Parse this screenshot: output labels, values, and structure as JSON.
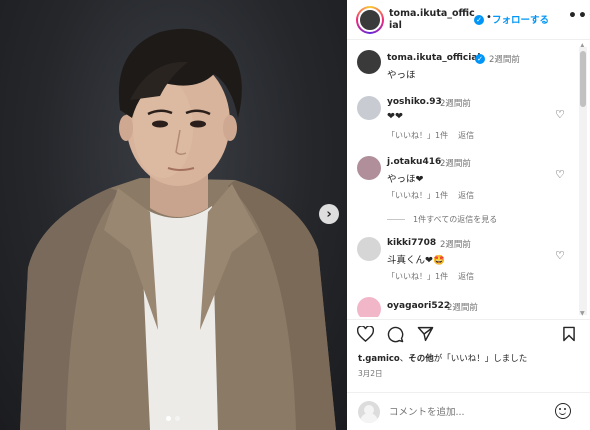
{
  "post": {
    "username": "toma.ikuta_official",
    "follow_label": "フォローする",
    "separator": "•",
    "more_label": "•••",
    "verified_mark": "✓",
    "next_arrow": "›",
    "carousel": {
      "slides": 2,
      "active_index": 0
    }
  },
  "caption": {
    "username": "toma.ikuta_official",
    "time": "2週間前",
    "text": "やっほ"
  },
  "comments": [
    {
      "username": "yoshiko.93",
      "time": "2週間前",
      "text": "❤❤",
      "likes": "「いいね！」1件",
      "reply": "返信",
      "avatar_color": "#c8ccd2"
    },
    {
      "username": "j.otaku416",
      "time": "2週間前",
      "text": "やっほ❤",
      "likes": "「いいね！」1件",
      "reply": "返信",
      "avatar_color": "#b08f9a"
    },
    {
      "username": "kikki7708",
      "time": "2週間前",
      "text": "斗真くん❤🤩",
      "likes": "「いいね！」1件",
      "reply": "返信",
      "avatar_color": "#d6d6d6"
    },
    {
      "username": "oyagaori522",
      "time": "2週間前",
      "text": "",
      "likes": "",
      "reply": "",
      "avatar_color": "#f1b7c9"
    }
  ],
  "view_replies_label": "1件すべての返信を見る",
  "likes_line": {
    "users": "t.gamico",
    "connector": "、",
    "others": "その他",
    "suffix": "が「いいね！」しました"
  },
  "date": "3月2日",
  "comment_input": {
    "placeholder": "コメントを追加..."
  },
  "icons": {
    "heart": "heart-icon",
    "comment": "comment-icon",
    "share": "share-icon",
    "bookmark": "bookmark-icon",
    "emoji": "emoji-icon"
  },
  "colors": {
    "accent": "#0095f6",
    "muted": "#737373",
    "text": "#262626"
  }
}
